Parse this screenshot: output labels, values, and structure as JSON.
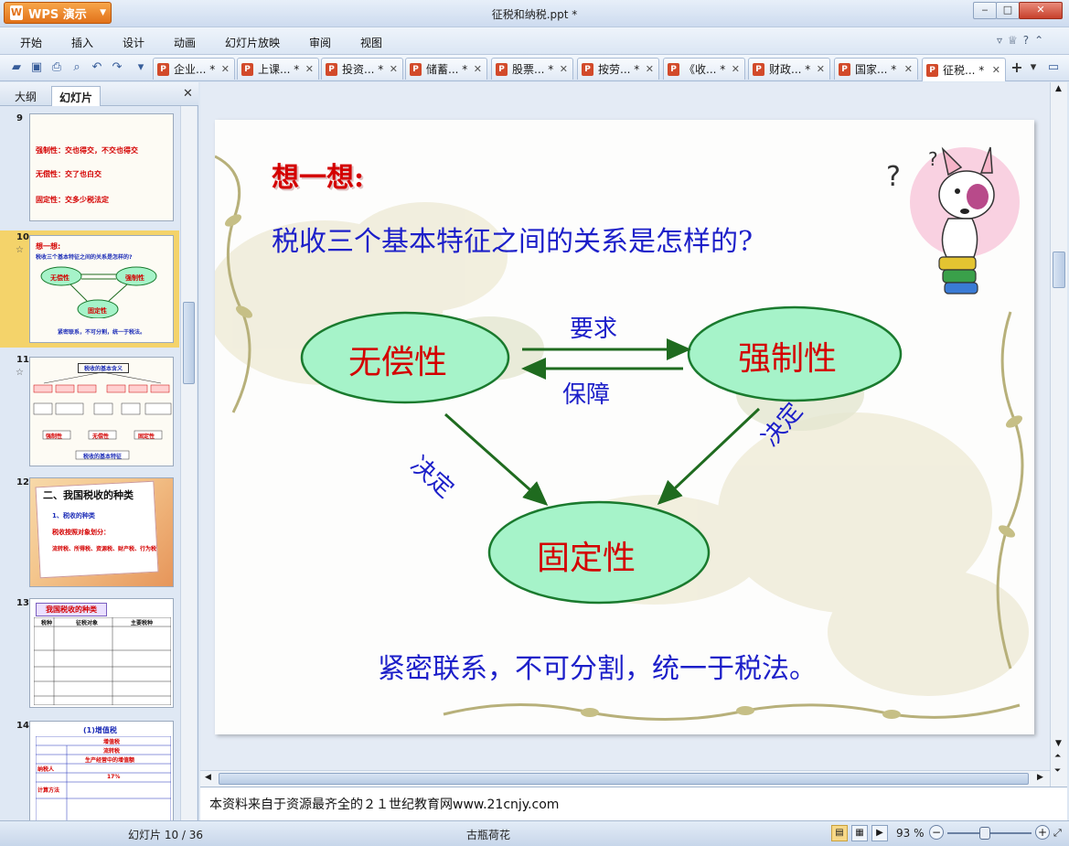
{
  "window": {
    "app_button": "WPS 演示",
    "title": "征税和纳税.ppt *"
  },
  "menu": [
    "开始",
    "插入",
    "设计",
    "动画",
    "幻灯片放映",
    "审阅",
    "视图"
  ],
  "doc_tabs": [
    "企业... *",
    "上课... *",
    "投资... *",
    "储蓄... *",
    "股票... *",
    "按劳... *",
    "《收... *",
    "财政... *",
    "国家... *",
    "征税... *"
  ],
  "active_tab_index": 9,
  "panel": {
    "tabs": [
      "大纲",
      "幻灯片"
    ],
    "active_tab": "幻灯片"
  },
  "thumbnails": [
    {
      "number": "9",
      "lines": [
        "强制性：交也得交，不交也得交",
        "无偿性：交了也白交",
        "固定性：交多少税法定"
      ]
    },
    {
      "number": "10",
      "selected": true,
      "lines": [
        "想一想:",
        "税收三个基本特征之间的关系是怎样的?",
        "无偿性",
        "强制性",
        "固定性",
        "紧密联系，不可分割，统一于税法。"
      ]
    },
    {
      "number": "11",
      "lines": [
        "税收的基本含义",
        "强制性",
        "无偿性",
        "固定性",
        "税收的基本特征"
      ]
    },
    {
      "number": "12",
      "lines": [
        "二、我国税收的种类",
        "1、税收的种类",
        "税收按照对象划分：",
        "流转税、所得税、资源税、财产税、行为税"
      ]
    },
    {
      "number": "13",
      "lines": [
        "我国税收的种类",
        "税种",
        "征税对象",
        "主要税种"
      ]
    },
    {
      "number": "14",
      "lines": [
        "(1)增值税",
        "增值税",
        "流转税",
        "生产经营中的增值额",
        "纳税人",
        "17%",
        "计算方法"
      ]
    }
  ],
  "slide": {
    "heading": "想一想:",
    "question": "税收三个基本特征之间的关系是怎样的?",
    "nodes": {
      "left": "无偿性",
      "right": "强制性",
      "bottom": "固定性"
    },
    "arrow_labels": {
      "top": "要求",
      "back": "保障",
      "left_diag": "决定",
      "right_diag": "决定"
    },
    "summary": "紧密联系，不可分割，统一于税法。",
    "colors": {
      "oval_fill": "#a6f3c9",
      "oval_stroke": "#1a7a2e",
      "arrow": "#1f6b1f",
      "node_text": "#d40000",
      "body_text": "#1c1fc9"
    }
  },
  "notes": "本资料来自于资源最齐全的２１世纪教育网www.21cnjy.com",
  "status": {
    "slide_indicator": "幻灯片 10 / 36",
    "theme": "古瓶荷花",
    "zoom": "93 %"
  }
}
